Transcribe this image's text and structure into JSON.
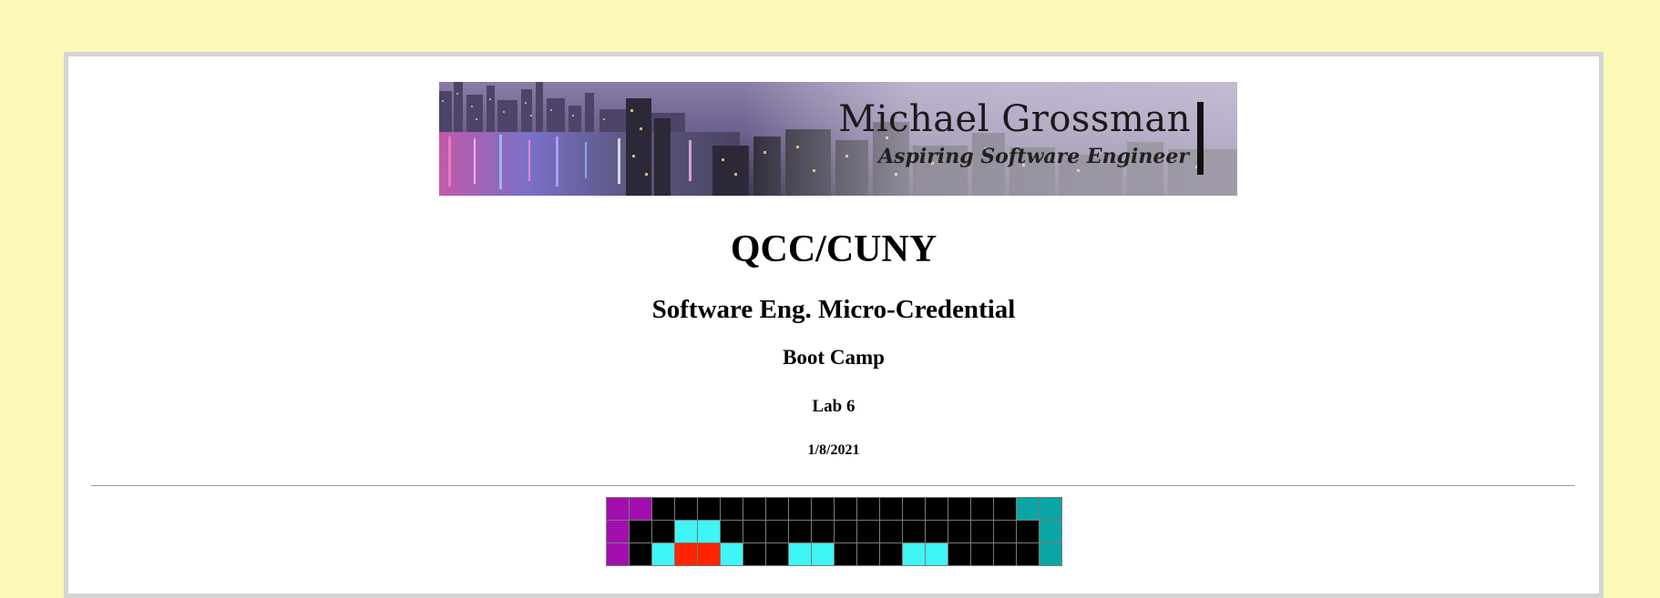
{
  "banner": {
    "name": "Michael Grossman",
    "tagline": "Aspiring Software Engineer"
  },
  "headings": {
    "school": "QCC/CUNY",
    "program": "Software Eng. Micro-Credential",
    "course": "Boot Camp",
    "lab": "Lab 6",
    "date": "1/8/2021"
  },
  "pixel_art": {
    "palette": {
      "K": "#000000",
      "M": "#a30fae",
      "C": "#3ff5f5",
      "T": "#0aa5a5",
      "R": "#ff2400"
    },
    "rows": [
      "MMKKKKKKKKKKKKKKKKTT",
      "MKKCCKKKKKKKKKKKKKKT",
      "MKCRRCKKCCKKKCCKKKKT"
    ]
  }
}
